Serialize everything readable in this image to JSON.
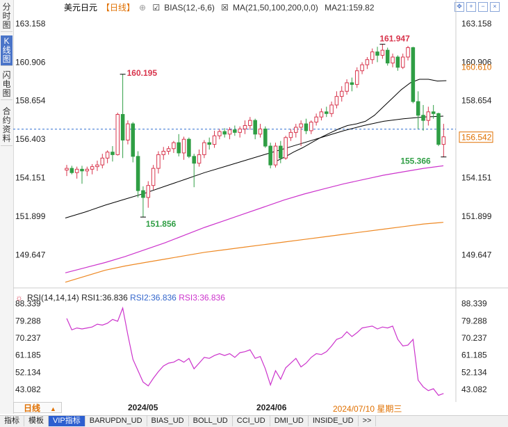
{
  "left_tabs": [
    "分时图",
    "K线图",
    "闪电图",
    "合约资料"
  ],
  "header": {
    "title": "美元日元",
    "period": "【日线】",
    "ind1": "BIAS(12,-6,6)",
    "ind2": "MA(21,50,100,200,0,0)",
    "ma21": "MA21:159.82"
  },
  "rsi_header": {
    "label": "RSI(14,14,14)",
    "rsi1": "RSI1:36.836",
    "rsi2": "RSI2:36.836",
    "rsi3": "RSI3:36.836"
  },
  "bottom_bar": {
    "period_label": "日线",
    "dates": [
      "2024/05",
      "2024/06"
    ],
    "current": "2024/07/10 星期三"
  },
  "bottom_tabs": [
    "指标",
    "模板",
    "VIP指标",
    "BARUPDN_UD",
    "BIAS_UD",
    "BOLL_UD",
    "CCI_UD",
    "DMI_UD",
    "INSIDE_UD",
    ">>"
  ],
  "price_axis": [
    "163.158",
    "160.906",
    "158.654",
    "156.403",
    "154.151",
    "151.899",
    "149.647"
  ],
  "rsi_axis": [
    "88.339",
    "79.288",
    "70.237",
    "61.185",
    "52.134",
    "43.082"
  ],
  "colors": {
    "up": "#d8344c",
    "down": "#2f9e44",
    "ma21": "#000000",
    "ma100": "#cc33cc",
    "ma200": "#ee8822",
    "rsi": "#cc33cc"
  },
  "chart_data": [
    {
      "type": "candlestick",
      "title": "美元日元",
      "ylim": [
        147.8,
        163.8
      ],
      "price_markers": {
        "last_close": "156.542",
        "ma_level": "160.610"
      },
      "annotations": [
        {
          "text": "160.195",
          "x": "2024-04-29"
        },
        {
          "text": "151.856",
          "x": "2024-05-03"
        },
        {
          "text": "161.947",
          "x": "2024-07-03"
        },
        {
          "text": "155.366",
          "x": "2024-07-11"
        }
      ],
      "ohlc": [
        {
          "o": 154.6,
          "h": 154.9,
          "l": 154.25,
          "c": 154.7
        },
        {
          "o": 154.7,
          "h": 154.85,
          "l": 154.35,
          "c": 154.45
        },
        {
          "o": 154.45,
          "h": 154.8,
          "l": 154.1,
          "c": 154.65
        },
        {
          "o": 154.65,
          "h": 154.85,
          "l": 153.8,
          "c": 154.55
        },
        {
          "o": 154.55,
          "h": 154.8,
          "l": 154.25,
          "c": 154.65
        },
        {
          "o": 154.65,
          "h": 154.95,
          "l": 154.35,
          "c": 154.8
        },
        {
          "o": 154.8,
          "h": 155.15,
          "l": 154.55,
          "c": 154.9
        },
        {
          "o": 154.9,
          "h": 155.55,
          "l": 154.7,
          "c": 155.3
        },
        {
          "o": 155.3,
          "h": 155.75,
          "l": 155.0,
          "c": 155.65
        },
        {
          "o": 155.65,
          "h": 156.0,
          "l": 155.1,
          "c": 155.5
        },
        {
          "o": 155.5,
          "h": 157.95,
          "l": 155.45,
          "c": 157.85
        },
        {
          "o": 157.85,
          "h": 160.195,
          "l": 155.3,
          "c": 156.35
        },
        {
          "o": 156.35,
          "h": 157.5,
          "l": 156.1,
          "c": 157.3
        },
        {
          "o": 157.3,
          "h": 157.4,
          "l": 155.05,
          "c": 155.4
        },
        {
          "o": 155.4,
          "h": 155.7,
          "l": 153.0,
          "c": 153.4
        },
        {
          "o": 153.4,
          "h": 153.65,
          "l": 151.856,
          "c": 153.0
        },
        {
          "o": 153.0,
          "h": 153.95,
          "l": 152.4,
          "c": 153.7
        },
        {
          "o": 153.7,
          "h": 154.9,
          "l": 153.45,
          "c": 154.7
        },
        {
          "o": 154.7,
          "h": 155.7,
          "l": 154.4,
          "c": 155.5
        },
        {
          "o": 155.5,
          "h": 155.95,
          "l": 155.2,
          "c": 155.7
        },
        {
          "o": 155.7,
          "h": 156.0,
          "l": 155.5,
          "c": 155.85
        },
        {
          "o": 155.85,
          "h": 156.3,
          "l": 155.6,
          "c": 156.2
        },
        {
          "o": 156.2,
          "h": 156.7,
          "l": 155.4,
          "c": 155.6
        },
        {
          "o": 155.6,
          "h": 156.55,
          "l": 155.2,
          "c": 156.4
        },
        {
          "o": 156.4,
          "h": 156.5,
          "l": 155.3,
          "c": 155.4
        },
        {
          "o": 155.4,
          "h": 155.55,
          "l": 153.6,
          "c": 155.0
        },
        {
          "o": 155.0,
          "h": 155.8,
          "l": 154.8,
          "c": 155.5
        },
        {
          "o": 155.5,
          "h": 156.35,
          "l": 155.3,
          "c": 156.2
        },
        {
          "o": 156.2,
          "h": 156.5,
          "l": 155.8,
          "c": 156.1
        },
        {
          "o": 156.1,
          "h": 156.9,
          "l": 155.9,
          "c": 156.6
        },
        {
          "o": 156.6,
          "h": 157.0,
          "l": 156.4,
          "c": 156.85
        },
        {
          "o": 156.85,
          "h": 157.05,
          "l": 156.5,
          "c": 156.7
        },
        {
          "o": 156.7,
          "h": 157.1,
          "l": 156.4,
          "c": 156.95
        },
        {
          "o": 156.95,
          "h": 157.2,
          "l": 156.6,
          "c": 156.8
        },
        {
          "o": 156.8,
          "h": 157.15,
          "l": 156.5,
          "c": 157.0
        },
        {
          "o": 157.0,
          "h": 157.5,
          "l": 156.7,
          "c": 157.2
        },
        {
          "o": 157.2,
          "h": 157.7,
          "l": 156.95,
          "c": 157.5
        },
        {
          "o": 157.5,
          "h": 157.6,
          "l": 156.4,
          "c": 156.7
        },
        {
          "o": 156.7,
          "h": 157.3,
          "l": 156.5,
          "c": 157.0
        },
        {
          "o": 157.0,
          "h": 157.15,
          "l": 155.9,
          "c": 156.0
        },
        {
          "o": 156.0,
          "h": 156.2,
          "l": 154.7,
          "c": 154.9
        },
        {
          "o": 154.9,
          "h": 156.2,
          "l": 154.75,
          "c": 156.0
        },
        {
          "o": 156.0,
          "h": 156.3,
          "l": 155.0,
          "c": 155.3
        },
        {
          "o": 155.3,
          "h": 156.6,
          "l": 155.2,
          "c": 156.5
        },
        {
          "o": 156.5,
          "h": 157.0,
          "l": 156.3,
          "c": 156.8
        },
        {
          "o": 156.8,
          "h": 157.3,
          "l": 156.5,
          "c": 157.1
        },
        {
          "o": 157.1,
          "h": 157.5,
          "l": 156.0,
          "c": 157.3
        },
        {
          "o": 157.3,
          "h": 157.6,
          "l": 156.7,
          "c": 156.9
        },
        {
          "o": 156.9,
          "h": 157.5,
          "l": 156.7,
          "c": 157.4
        },
        {
          "o": 157.4,
          "h": 157.9,
          "l": 157.2,
          "c": 157.7
        },
        {
          "o": 157.7,
          "h": 158.2,
          "l": 157.5,
          "c": 158.0
        },
        {
          "o": 158.0,
          "h": 158.3,
          "l": 157.7,
          "c": 157.9
        },
        {
          "o": 157.9,
          "h": 158.6,
          "l": 157.7,
          "c": 158.4
        },
        {
          "o": 158.4,
          "h": 159.2,
          "l": 158.2,
          "c": 158.9
        },
        {
          "o": 158.9,
          "h": 159.5,
          "l": 158.6,
          "c": 159.2
        },
        {
          "o": 159.2,
          "h": 159.9,
          "l": 159.0,
          "c": 159.7
        },
        {
          "o": 159.7,
          "h": 160.0,
          "l": 159.2,
          "c": 159.6
        },
        {
          "o": 159.6,
          "h": 160.6,
          "l": 159.4,
          "c": 160.4
        },
        {
          "o": 160.4,
          "h": 160.9,
          "l": 160.2,
          "c": 160.75
        },
        {
          "o": 160.75,
          "h": 161.2,
          "l": 160.5,
          "c": 161.05
        },
        {
          "o": 161.05,
          "h": 161.7,
          "l": 160.8,
          "c": 161.5
        },
        {
          "o": 161.5,
          "h": 161.8,
          "l": 160.9,
          "c": 161.3
        },
        {
          "o": 161.3,
          "h": 161.947,
          "l": 161.1,
          "c": 161.6
        },
        {
          "o": 161.6,
          "h": 161.75,
          "l": 160.7,
          "c": 160.85
        },
        {
          "o": 160.85,
          "h": 161.4,
          "l": 160.6,
          "c": 161.2
        },
        {
          "o": 161.2,
          "h": 161.3,
          "l": 160.4,
          "c": 160.6
        },
        {
          "o": 160.6,
          "h": 161.4,
          "l": 160.5,
          "c": 161.2
        },
        {
          "o": 161.2,
          "h": 161.85,
          "l": 161.0,
          "c": 161.75
        },
        {
          "o": 161.75,
          "h": 161.8,
          "l": 158.5,
          "c": 158.6
        },
        {
          "o": 158.6,
          "h": 159.2,
          "l": 157.0,
          "c": 157.8
        },
        {
          "o": 157.8,
          "h": 158.4,
          "l": 156.9,
          "c": 157.5
        },
        {
          "o": 157.5,
          "h": 158.3,
          "l": 157.2,
          "c": 158.0
        },
        {
          "o": 158.0,
          "h": 158.4,
          "l": 157.6,
          "c": 157.9
        },
        {
          "o": 157.9,
          "h": 157.95,
          "l": 156.0,
          "c": 156.1
        },
        {
          "o": 156.1,
          "h": 157.3,
          "l": 155.366,
          "c": 156.542
        }
      ],
      "ma21": [
        155.1,
        155.35,
        155.65,
        155.9,
        156.2,
        156.5,
        156.75,
        157.0,
        157.2,
        157.3,
        157.45,
        157.8,
        158.3,
        158.8,
        159.3,
        159.7,
        159.9,
        159.9,
        159.8,
        159.82
      ],
      "ma50": [
        151.8,
        152.15,
        152.55,
        152.9,
        153.25,
        153.65,
        154.05,
        154.45,
        154.8,
        155.15,
        155.5,
        155.85,
        156.2,
        156.55,
        156.9,
        157.2,
        157.45,
        157.6,
        157.7,
        157.75
      ],
      "ma100": [
        148.6,
        148.9,
        149.2,
        149.55,
        149.95,
        150.35,
        150.8,
        151.25,
        151.65,
        152.05,
        152.45,
        152.85,
        153.2,
        153.5,
        153.8,
        154.05,
        154.3,
        154.5,
        154.7,
        154.85
      ],
      "ma200": [
        148.05,
        148.4,
        148.75,
        149.0,
        149.2,
        149.4,
        149.6,
        149.8,
        149.95,
        150.1,
        150.25,
        150.4,
        150.55,
        150.7,
        150.85,
        151.0,
        151.15,
        151.3,
        151.45,
        151.55
      ]
    },
    {
      "type": "line",
      "title": "RSI(14,14,14)",
      "ylim": [
        38.0,
        90.0
      ],
      "series": [
        {
          "name": "RSI1",
          "values": [
            80.5,
            74.5,
            75.5,
            75.0,
            75.5,
            76.0,
            77.5,
            77.0,
            78.0,
            80.0,
            79.0,
            86.0,
            72.0,
            59.0,
            53.0,
            47.0,
            45.0,
            49.0,
            52.5,
            55.5,
            57.0,
            57.5,
            59.0,
            57.5,
            59.5,
            54.0,
            57.0,
            60.0,
            59.5,
            61.0,
            62.0,
            61.0,
            62.0,
            60.0,
            62.5,
            63.0,
            64.0,
            59.5,
            60.5,
            54.0,
            45.5,
            53.0,
            48.5,
            54.5,
            57.0,
            59.5,
            55.0,
            57.0,
            60.0,
            62.0,
            61.5,
            63.0,
            66.0,
            69.5,
            70.5,
            73.5,
            71.0,
            73.0,
            75.5,
            76.0,
            76.5,
            75.0,
            76.0,
            75.5,
            76.5,
            69.5,
            66.0,
            66.5,
            69.5,
            48.0,
            44.5,
            42.5,
            43.5,
            40.0,
            41.0
          ]
        }
      ]
    }
  ]
}
